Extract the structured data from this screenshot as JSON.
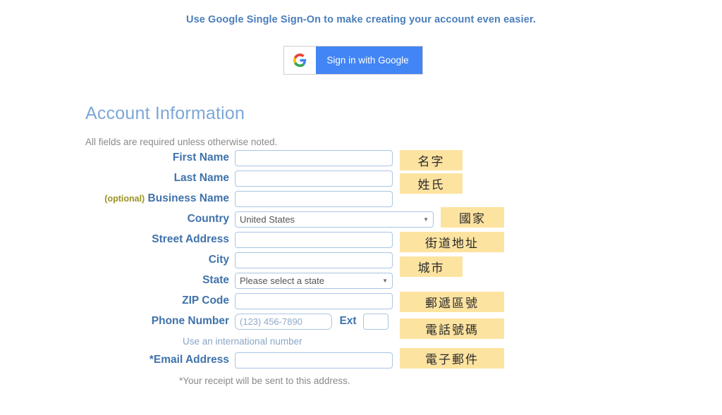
{
  "sso": {
    "headline": "Use Google Single Sign-On to make creating your account even easier.",
    "button_label": "Sign in with Google",
    "button_icon": "google-g-icon",
    "button_bg": "#4285f4"
  },
  "section": {
    "title": "Account Information",
    "note": "All fields are required unless otherwise noted.",
    "title_color": "#7da7d9"
  },
  "form": {
    "label_color": "#3f72ab",
    "optional_color": "#9a9222",
    "input_border_color": "#a9c5e3",
    "rows": [
      {
        "label": "First Name",
        "optional": "",
        "type": "text",
        "value": "",
        "placeholder": ""
      },
      {
        "label": "Last Name",
        "optional": "",
        "type": "text",
        "value": "",
        "placeholder": ""
      },
      {
        "label": "Business Name",
        "optional": "(optional)",
        "type": "text",
        "value": "",
        "placeholder": ""
      },
      {
        "label": "Country",
        "optional": "",
        "type": "select",
        "value": "United States"
      },
      {
        "label": "Street Address",
        "optional": "",
        "type": "text",
        "value": "",
        "placeholder": ""
      },
      {
        "label": "City",
        "optional": "",
        "type": "text",
        "value": "",
        "placeholder": ""
      },
      {
        "label": "State",
        "optional": "",
        "type": "select",
        "value": "Please select a state"
      },
      {
        "label": "ZIP Code",
        "optional": "",
        "type": "text",
        "value": "",
        "placeholder": ""
      },
      {
        "label": "Phone Number",
        "optional": "",
        "type": "phone",
        "value": "",
        "placeholder": "(123) 456-7890",
        "ext_label": "Ext",
        "ext_value": ""
      },
      {
        "label": "*Email Address",
        "optional": "",
        "type": "text",
        "value": "",
        "placeholder": ""
      }
    ],
    "helper_phone": "Use an international number",
    "helper_email": "*Your receipt will be sent to this address."
  },
  "annotations": {
    "bg": "#fde3a0",
    "items": [
      {
        "text": "名字",
        "for": "first-name"
      },
      {
        "text": "姓氏",
        "for": "last-name"
      },
      {
        "text": "國家",
        "for": "country"
      },
      {
        "text": "街道地址",
        "for": "street-address"
      },
      {
        "text": "城市",
        "for": "city"
      },
      {
        "text": "郵遞區號",
        "for": "zip-code"
      },
      {
        "text": "電話號碼",
        "for": "phone-number"
      },
      {
        "text": "電子郵件",
        "for": "email-address"
      }
    ]
  }
}
